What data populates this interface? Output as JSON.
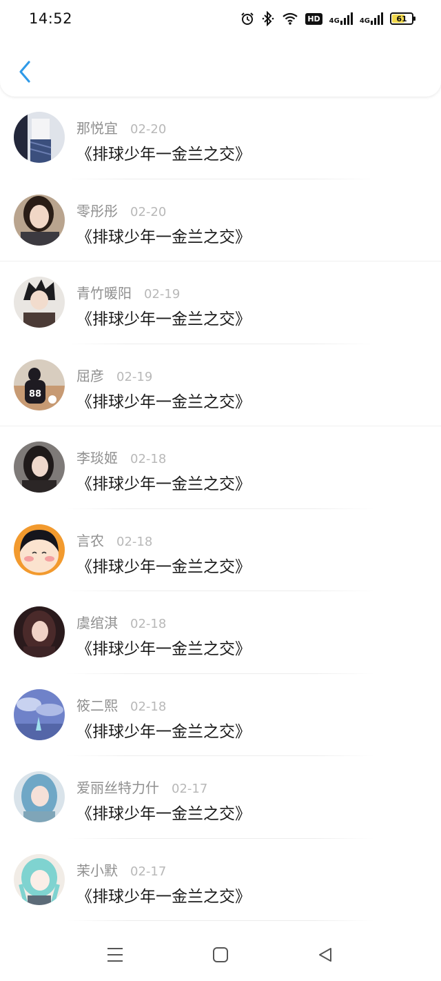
{
  "status_bar": {
    "time": "14:52",
    "battery": "61",
    "icons": [
      "alarm-icon",
      "bluetooth-icon",
      "wifi-icon",
      "hd-icon",
      "signal-4g-icon",
      "signal-4g-icon",
      "battery-icon"
    ],
    "hd_label": "HD",
    "net_label": "4G"
  },
  "header": {
    "back_icon": "chevron-left-icon",
    "accent": "#2f9ae8"
  },
  "list": [
    {
      "name": "那悦宜",
      "date": "02-20",
      "message": "《排球少年一金兰之交》"
    },
    {
      "name": "零彤彤",
      "date": "02-20",
      "message": "《排球少年一金兰之交》"
    },
    {
      "name": "青竹暖阳",
      "date": "02-19",
      "message": "《排球少年一金兰之交》"
    },
    {
      "name": "屈彦",
      "date": "02-19",
      "message": "《排球少年一金兰之交》"
    },
    {
      "name": "李琰姬",
      "date": "02-18",
      "message": "《排球少年一金兰之交》"
    },
    {
      "name": "言农",
      "date": "02-18",
      "message": "《排球少年一金兰之交》"
    },
    {
      "name": "虞绾淇",
      "date": "02-18",
      "message": "《排球少年一金兰之交》"
    },
    {
      "name": "筱二熙",
      "date": "02-18",
      "message": "《排球少年一金兰之交》"
    },
    {
      "name": "爱丽丝特力什",
      "date": "02-17",
      "message": "《排球少年一金兰之交》"
    },
    {
      "name": "茉小默",
      "date": "02-17",
      "message": "《排球少年一金兰之交》"
    }
  ],
  "nav": {
    "icons": [
      "menu-icon",
      "home-square-icon",
      "back-triangle-icon"
    ]
  }
}
